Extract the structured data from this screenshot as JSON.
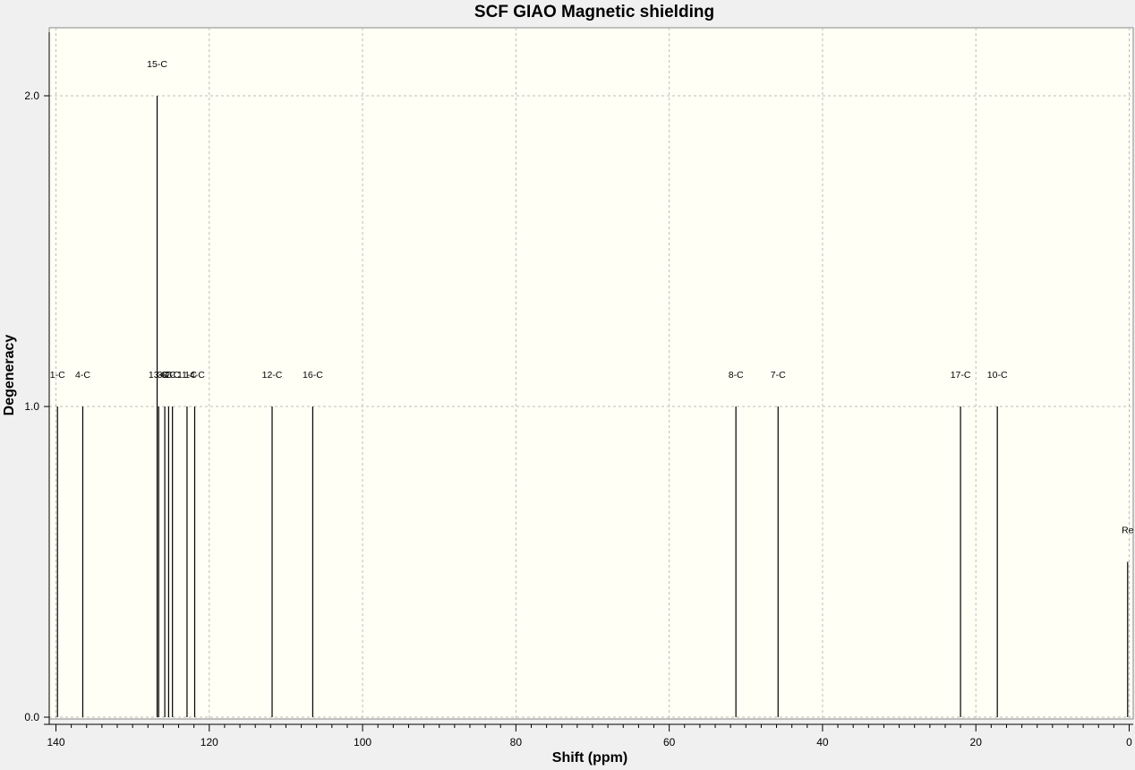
{
  "chart_data": {
    "type": "bar",
    "title": "SCF GIAO Magnetic shielding",
    "xlabel": "Shift (ppm)",
    "ylabel": "Degeneracy",
    "xlim": [
      140,
      0
    ],
    "ylim": [
      0,
      2.2
    ],
    "x_ticks": [
      "140",
      "120",
      "100",
      "80",
      "60",
      "40",
      "20",
      "0"
    ],
    "y_ticks": [
      "0.0",
      "1.0",
      "2.0"
    ],
    "grid": true,
    "peaks": [
      {
        "label": "1-C",
        "x": 139.8,
        "y": 1.0
      },
      {
        "label": "4-C",
        "x": 136.5,
        "y": 1.0
      },
      {
        "label": "15-C",
        "x": 126.8,
        "y": 2.0
      },
      {
        "label": "13-C",
        "x": 126.6,
        "y": 1.0
      },
      {
        "label": "3-C",
        "x": 125.8,
        "y": 1.0
      },
      {
        "label": "6-C",
        "x": 125.3,
        "y": 1.0
      },
      {
        "label": "2-C",
        "x": 124.8,
        "y": 1.0
      },
      {
        "label": "11-C",
        "x": 122.9,
        "y": 1.0
      },
      {
        "label": "14-C",
        "x": 121.9,
        "y": 1.0
      },
      {
        "label": "12-C",
        "x": 111.8,
        "y": 1.0
      },
      {
        "label": "16-C",
        "x": 106.5,
        "y": 1.0
      },
      {
        "label": "8-C",
        "x": 51.3,
        "y": 1.0
      },
      {
        "label": "7-C",
        "x": 45.8,
        "y": 1.0
      },
      {
        "label": "17-C",
        "x": 22.0,
        "y": 1.0
      },
      {
        "label": "10-C",
        "x": 17.2,
        "y": 1.0
      },
      {
        "label": "Re",
        "x": 0.2,
        "y": 0.5
      }
    ],
    "colors": {
      "background": "#fffff5",
      "bar": "#000000",
      "grid": "#bdbdbd"
    }
  }
}
